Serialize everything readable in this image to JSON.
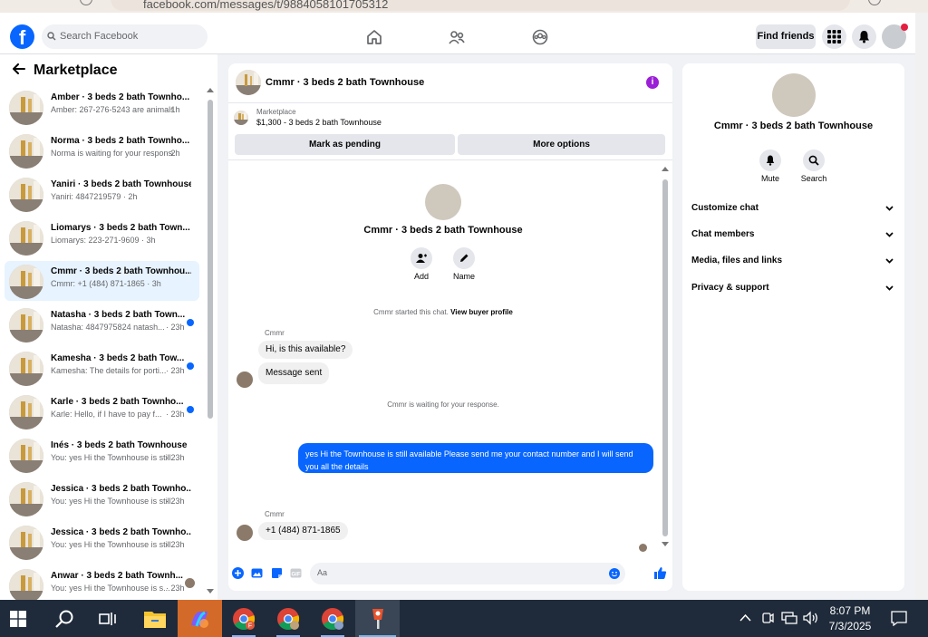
{
  "browser": {
    "url": "facebook.com/messages/t/9884058101705312"
  },
  "header": {
    "search_placeholder": "Search Facebook",
    "find_friends": "Find friends"
  },
  "marketplace": {
    "title": "Marketplace"
  },
  "conversations": [
    {
      "title": "Amber · 3 beds 2 bath Townho...",
      "preview": "Amber: 267-276-5243 are animals...",
      "time": "· 1h",
      "unread": false
    },
    {
      "title": "Norma · 3 beds 2 bath Townho...",
      "preview": "Norma is waiting for your response.",
      "time": "· 2h",
      "unread": false
    },
    {
      "title": "Yaniri · 3 beds 2 bath Townhouse",
      "preview": "Yaniri: 4847219579 · 2h",
      "time": "",
      "unread": false
    },
    {
      "title": "Liomarys · 3 beds 2 bath Town...",
      "preview": "Liomarys: 223-271-9609 · 3h",
      "time": "",
      "unread": false
    },
    {
      "title": "Cmmr · 3 beds 2 bath Townhou...",
      "preview": "Cmmr: +1 (484) 871-1865 · 3h",
      "time": "",
      "unread": false,
      "selected": true
    },
    {
      "title": "Natasha · 3 beds 2 bath Town...",
      "preview": "Natasha: 4847975824 natash...",
      "time": "· 23h",
      "unread": true
    },
    {
      "title": "Kamesha · 3 beds 2 bath Tow...",
      "preview": "Kamesha: The details for porti...",
      "time": "· 23h",
      "unread": true
    },
    {
      "title": "Karle · 3 beds 2 bath Townho...",
      "preview": "Karle: Hello, if I have to pay f...",
      "time": "· 23h",
      "unread": true
    },
    {
      "title": "Inés · 3 beds 2 bath Townhouse",
      "preview": "You: yes Hi the Townhouse is still...",
      "time": "· 23h",
      "unread": false
    },
    {
      "title": "Jessica · 3 beds 2 bath Townho...",
      "preview": "You: yes Hi the Townhouse is still...",
      "time": "· 23h",
      "unread": false
    },
    {
      "title": "Jessica · 3 beds 2 bath Townho...",
      "preview": "You: yes Hi the Townhouse is still...",
      "time": "· 23h",
      "unread": false
    },
    {
      "title": "Anwar · 3 beds 2 bath Townh...",
      "preview": "You: yes Hi the Townhouse is s...",
      "time": "· 23h",
      "unread": false,
      "seen_avatar": true
    }
  ],
  "chat": {
    "header_name": "Cmmr · 3 beds 2 bath Townhouse",
    "marketplace_label": "Marketplace",
    "listing": "$1,300 - 3 beds 2 bath Townhouse",
    "mark_pending": "Mark as pending",
    "more_options": "More options",
    "profile_name": "Cmmr · 3 beds 2 bath Townhouse",
    "add_label": "Add",
    "name_label": "Name",
    "started": "Cmmr started this chat.",
    "view_buyer": "View buyer profile",
    "sender1": "Cmmr",
    "msg1": "Hi, is this available?",
    "msg2": "Message sent",
    "waiting": "Cmmr is waiting for your response.",
    "my_msg": "yes Hi the Townhouse is still available Please send me your contact number and I will send you all the details",
    "sender2": "Cmmr",
    "msg3": "+1 (484) 871-1865",
    "composer_placeholder": "Aa"
  },
  "info_panel": {
    "name": "Cmmr · 3 beds 2 bath Townhouse",
    "mute": "Mute",
    "search": "Search",
    "sections": [
      "Customize chat",
      "Chat members",
      "Media, files and links",
      "Privacy & support"
    ]
  },
  "taskbar": {
    "time": "8:07 PM",
    "date": "7/3/2025"
  },
  "colors": {
    "accent": "#0866ff",
    "my_bubble": "#0866ff",
    "info_icon": "#9a1fd6",
    "taskbar": "#1f2b3a"
  }
}
